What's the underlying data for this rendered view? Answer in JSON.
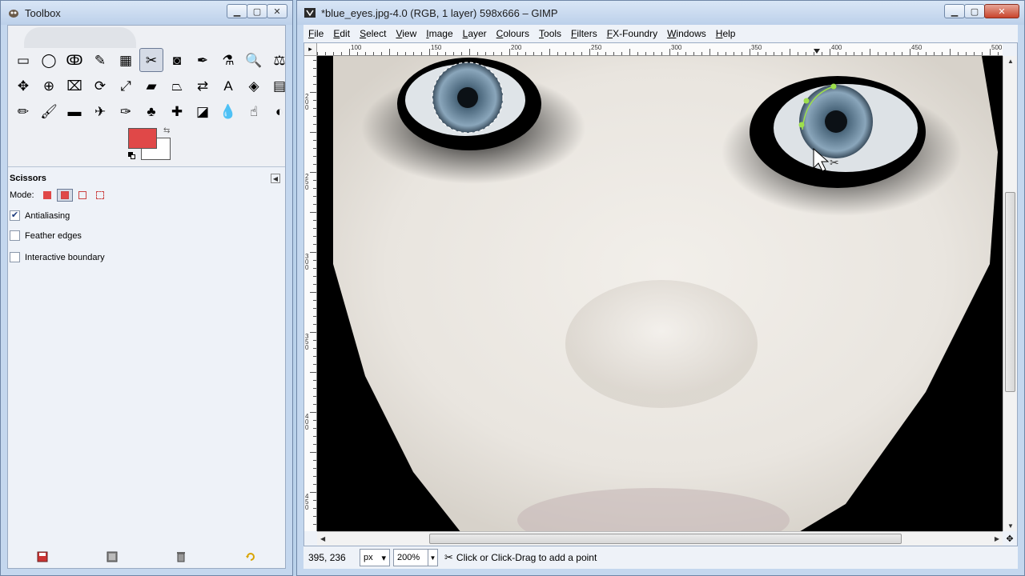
{
  "toolbox": {
    "title": "Toolbox",
    "tools": [
      {
        "name": "rect-select-icon",
        "glyph": "▭"
      },
      {
        "name": "ellipse-select-icon",
        "glyph": "◯"
      },
      {
        "name": "free-select-icon",
        "glyph": "ↂ"
      },
      {
        "name": "fuzzy-select-icon",
        "glyph": "✎"
      },
      {
        "name": "select-by-color-icon",
        "glyph": "▦"
      },
      {
        "name": "scissors-icon",
        "glyph": "✂",
        "active": true
      },
      {
        "name": "foreground-select-icon",
        "glyph": "◙"
      },
      {
        "name": "paths-icon",
        "glyph": "✒"
      },
      {
        "name": "color-picker-icon",
        "glyph": "⚗"
      },
      {
        "name": "zoom-icon",
        "glyph": "🔍"
      },
      {
        "name": "measure-icon",
        "glyph": "⚖"
      },
      {
        "name": "move-icon",
        "glyph": "✥"
      },
      {
        "name": "align-icon",
        "glyph": "⊕"
      },
      {
        "name": "crop-icon",
        "glyph": "⌧"
      },
      {
        "name": "rotate-icon",
        "glyph": "⟳"
      },
      {
        "name": "scale-icon",
        "glyph": "⤢"
      },
      {
        "name": "shear-icon",
        "glyph": "▰"
      },
      {
        "name": "perspective-icon",
        "glyph": "⏢"
      },
      {
        "name": "flip-icon",
        "glyph": "⇄"
      },
      {
        "name": "text-icon",
        "glyph": "A"
      },
      {
        "name": "bucket-fill-icon",
        "glyph": "◈"
      },
      {
        "name": "blend-icon",
        "glyph": "▤"
      },
      {
        "name": "pencil-icon",
        "glyph": "✏"
      },
      {
        "name": "paintbrush-icon",
        "glyph": "🖌"
      },
      {
        "name": "eraser-icon",
        "glyph": "▬"
      },
      {
        "name": "airbrush-icon",
        "glyph": "✈"
      },
      {
        "name": "ink-icon",
        "glyph": "✑"
      },
      {
        "name": "clone-icon",
        "glyph": "♣"
      },
      {
        "name": "heal-icon",
        "glyph": "✚"
      },
      {
        "name": "perspective-clone-icon",
        "glyph": "◪"
      },
      {
        "name": "blur-icon",
        "glyph": "💧"
      },
      {
        "name": "smudge-icon",
        "glyph": "☝"
      },
      {
        "name": "dodge-burn-icon",
        "glyph": "◐"
      }
    ],
    "fg_color": "#e04848",
    "bg_color": "#ffffff",
    "options": {
      "tool_name": "Scissors",
      "mode_label": "Mode:",
      "antialiasing": {
        "label": "Antialiasing",
        "checked": true
      },
      "feather": {
        "label": "Feather edges",
        "checked": false
      },
      "interactive": {
        "label": "Interactive boundary",
        "checked": false
      }
    }
  },
  "image_window": {
    "title": "*blue_eyes.jpg-4.0 (RGB, 1 layer) 598x666 – GIMP",
    "menu": [
      {
        "label": "File",
        "ul": "F",
        "rest": "ile"
      },
      {
        "label": "Edit",
        "ul": "E",
        "rest": "dit"
      },
      {
        "label": "Select",
        "ul": "S",
        "rest": "elect"
      },
      {
        "label": "View",
        "ul": "V",
        "rest": "iew"
      },
      {
        "label": "Image",
        "ul": "I",
        "rest": "mage"
      },
      {
        "label": "Layer",
        "ul": "L",
        "rest": "ayer"
      },
      {
        "label": "Colours",
        "ul": "C",
        "rest": "olours"
      },
      {
        "label": "Tools",
        "ul": "T",
        "rest": "ools"
      },
      {
        "label": "Filters",
        "ul": "F",
        "rest": "ilters"
      },
      {
        "label": "FX-Foundry",
        "ul": "F",
        "rest": "X-Foundry"
      },
      {
        "label": "Windows",
        "ul": "W",
        "rest": "indows"
      },
      {
        "label": "Help",
        "ul": "H",
        "rest": "elp"
      }
    ],
    "hruler_labels": [
      "100",
      "150",
      "200",
      "250",
      "300",
      "350",
      "400",
      "450",
      "500"
    ],
    "vruler_labels": [
      "200",
      "250",
      "300",
      "350",
      "400",
      "450"
    ],
    "status": {
      "coords": "395, 236",
      "unit": "px",
      "zoom": "200%",
      "message": "Click or Click-Drag to add a point"
    }
  }
}
